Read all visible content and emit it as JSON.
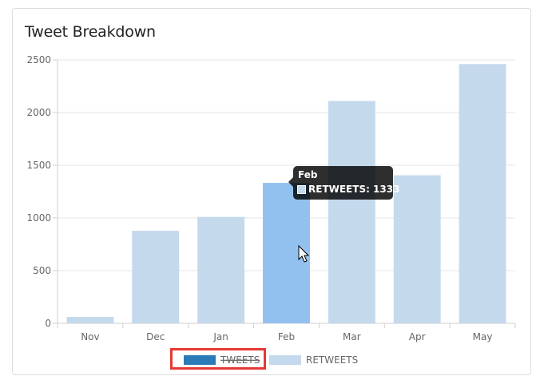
{
  "card": {
    "title": "Tweet Breakdown"
  },
  "chart_data": {
    "type": "bar",
    "categories": [
      "Nov",
      "Dec",
      "Jan",
      "Feb",
      "Mar",
      "Apr",
      "May"
    ],
    "series": [
      {
        "name": "TWEETS",
        "values": [
          0,
          0,
          0,
          0,
          0,
          0,
          0
        ],
        "color": "#2b7bb9",
        "hidden": true
      },
      {
        "name": "RETWEETS",
        "values": [
          60,
          878,
          1010,
          1333,
          2110,
          1405,
          2460
        ],
        "color": "#c5d9ed"
      }
    ],
    "hover_color": "#93c1ef",
    "hovered_index": 3,
    "ylim": [
      0,
      2500
    ],
    "yticks": [
      0,
      500,
      1000,
      1500,
      2000,
      2500
    ],
    "grid": true,
    "legend_position": "bottom"
  },
  "tooltip": {
    "title": "Feb",
    "body": "RETWEETS: 1333"
  },
  "colors": {
    "highlight_border": "#e53935"
  }
}
